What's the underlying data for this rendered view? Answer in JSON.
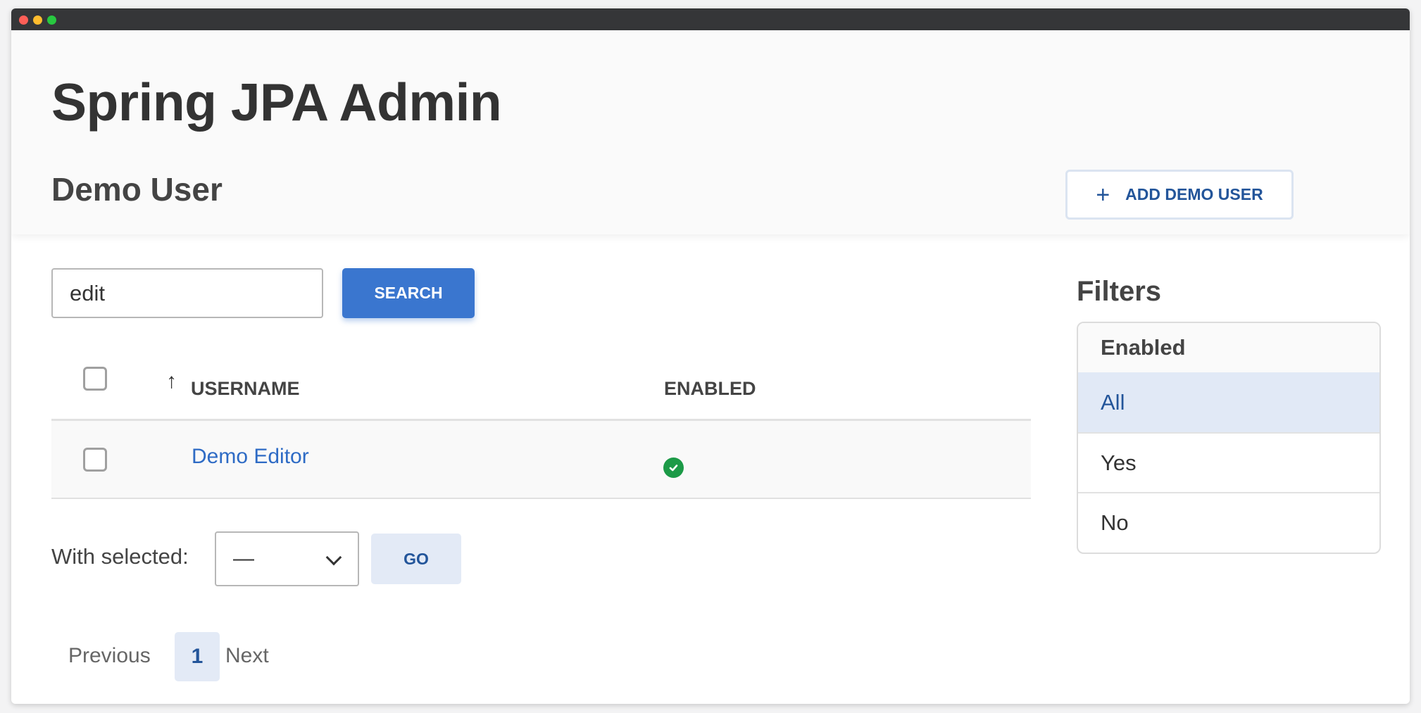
{
  "app": {
    "title": "Spring JPA Admin"
  },
  "page": {
    "title": "Demo User"
  },
  "actions": {
    "add_label": "ADD DEMO USER"
  },
  "search": {
    "value": "edit",
    "button_label": "SEARCH"
  },
  "table": {
    "columns": [
      {
        "label": "USERNAME",
        "sort": "ascending"
      },
      {
        "label": "ENABLED"
      }
    ],
    "rows": [
      {
        "username": "Demo Editor",
        "enabled": true,
        "enabled_icon": "check-circle-icon"
      }
    ]
  },
  "bulk": {
    "label": "With selected:",
    "selected_option": "—",
    "go_label": "GO"
  },
  "pagination": {
    "previous": "Previous",
    "current": "1",
    "next": "Next"
  },
  "filters": {
    "title": "Filters",
    "group": "Enabled",
    "options": [
      "All",
      "Yes",
      "No"
    ],
    "active": "All"
  },
  "colors": {
    "primary": "#3a76cf",
    "link": "#2e6bc5",
    "accent_dark": "#23559a",
    "success": "#1c9a47",
    "active_filter_bg": "#e1e9f6"
  }
}
